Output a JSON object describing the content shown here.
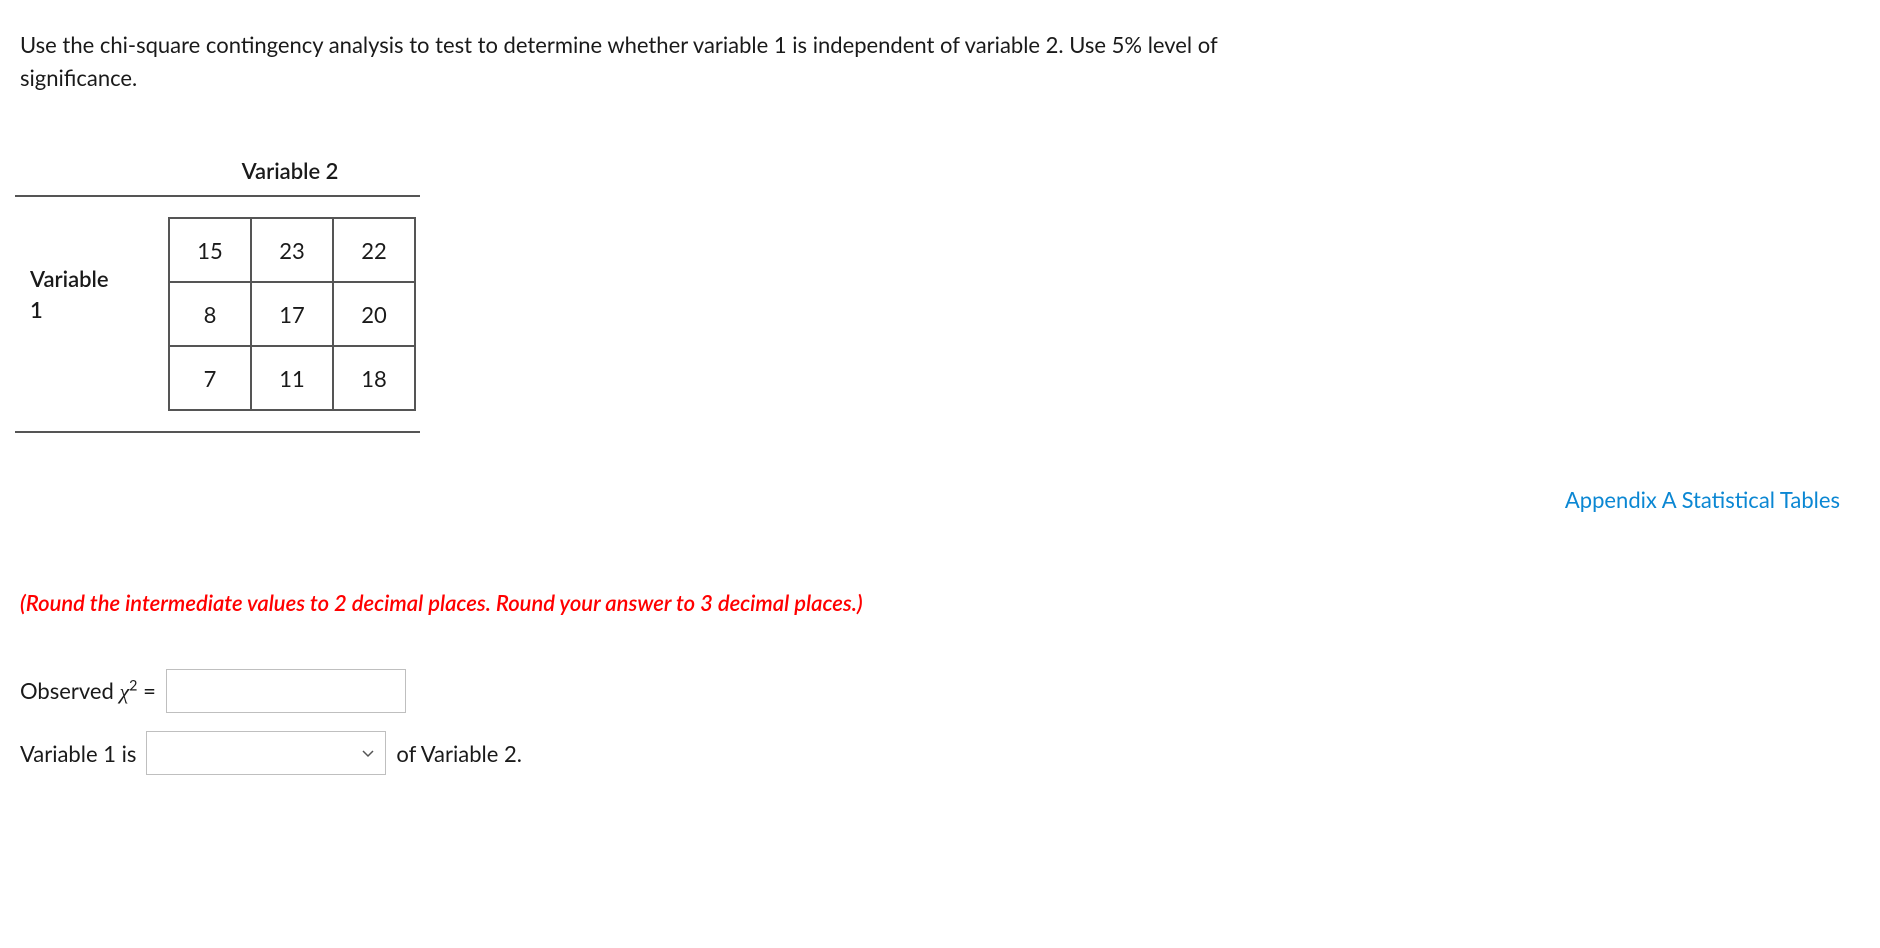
{
  "question_text": "Use the chi-square contingency analysis to test to determine whether variable 1 is independent of variable 2. Use 5% level of significance.",
  "table": {
    "var1_label_line1": "Variable",
    "var1_label_line2": "1",
    "var2_label": "Variable 2",
    "rows": [
      [
        "15",
        "23",
        "22"
      ],
      [
        "8",
        "17",
        "20"
      ],
      [
        "7",
        "11",
        "18"
      ]
    ]
  },
  "appendix_link_text": "Appendix A Statistical Tables",
  "instruction_text": "(Round the intermediate values to 2 decimal places. Round your answer to 3 decimal places.)",
  "answers": {
    "observed_prefix": "Observed ",
    "chi_symbol": "χ",
    "superscript": "2",
    "equals": " = ",
    "chi_value": "",
    "var1_prefix": "Variable 1 is ",
    "dropdown_value": "",
    "var1_suffix": "of Variable 2."
  }
}
